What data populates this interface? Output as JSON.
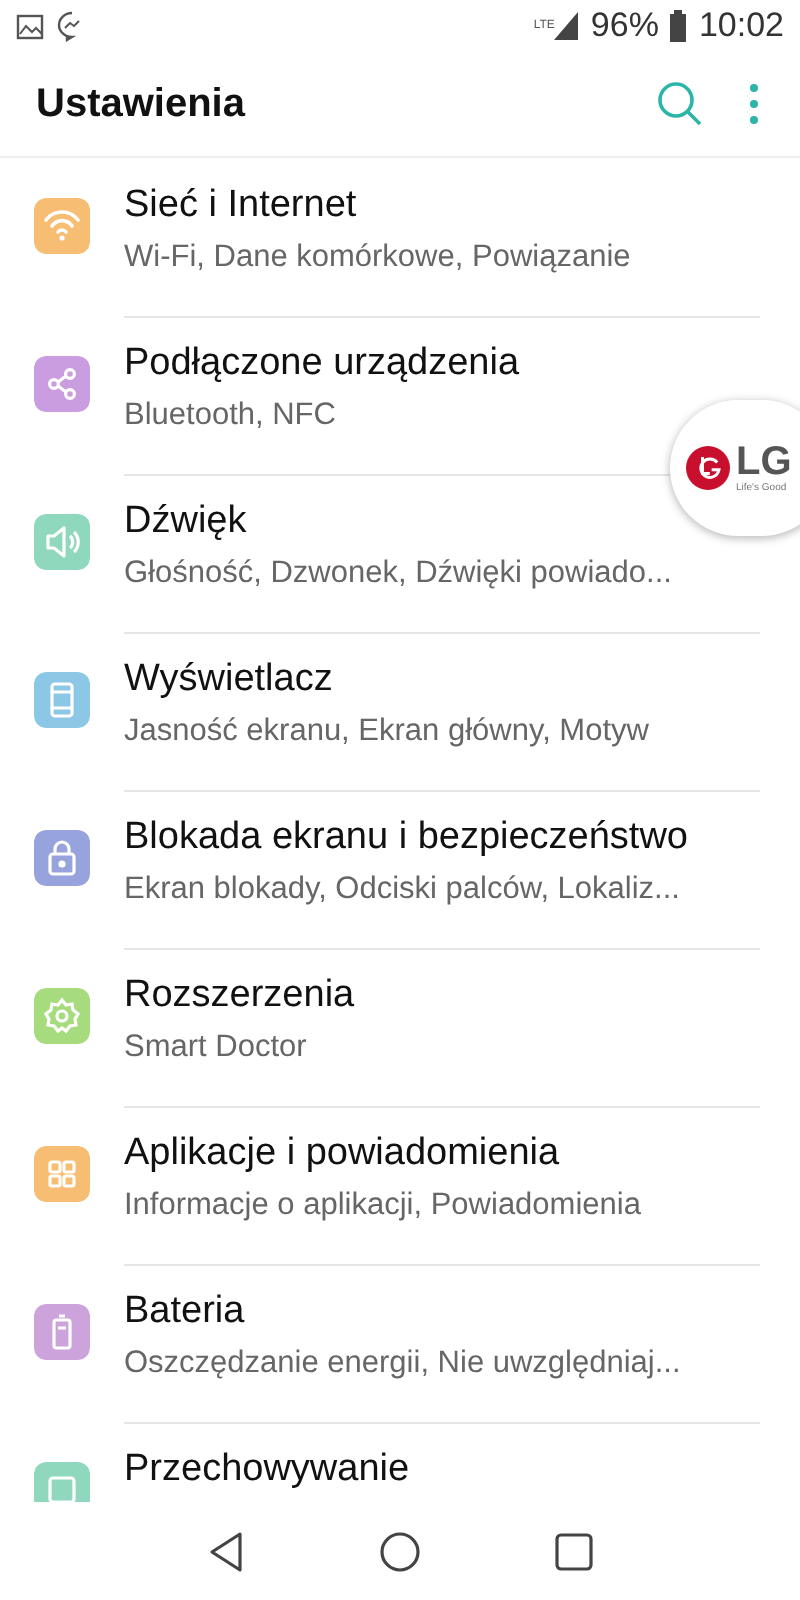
{
  "status_bar": {
    "network": "LTE",
    "battery": "96%",
    "time": "10:02"
  },
  "header": {
    "title": "Ustawienia"
  },
  "items": [
    {
      "kind": "wifi",
      "color": "#f6bd73",
      "title": "Sieć i Internet",
      "subtitle": "Wi-Fi, Dane komórkowe, Powiązanie"
    },
    {
      "kind": "share",
      "color": "#c99de0",
      "title": "Podłączone urządzenia",
      "subtitle": "Bluetooth, NFC"
    },
    {
      "kind": "sound",
      "color": "#8fd8bd",
      "title": "Dźwięk",
      "subtitle": "Głośność, Dzwonek, Dźwięki powiado..."
    },
    {
      "kind": "display",
      "color": "#8cc8e6",
      "title": "Wyświetlacz",
      "subtitle": "Jasność ekranu, Ekran główny, Motyw"
    },
    {
      "kind": "lock",
      "color": "#97a3dc",
      "title": "Blokada ekranu i bezpieczeństwo",
      "subtitle": "Ekran blokady, Odciski palców, Lokaliz..."
    },
    {
      "kind": "gear",
      "color": "#a6dc7e",
      "title": "Rozszerzenia",
      "subtitle": "Smart Doctor"
    },
    {
      "kind": "apps",
      "color": "#f6bd73",
      "title": "Aplikacje i powiadomienia",
      "subtitle": "Informacje o aplikacji, Powiadomienia"
    },
    {
      "kind": "battery",
      "color": "#cda3dc",
      "title": "Bateria",
      "subtitle": "Oszczędzanie energii, Nie uwzględniaj..."
    },
    {
      "kind": "storage",
      "color": "#8fd8bd",
      "title": "Przechowywanie"
    }
  ],
  "floating_bubble": {
    "logo": "LG",
    "slogan": "Life's Good"
  }
}
